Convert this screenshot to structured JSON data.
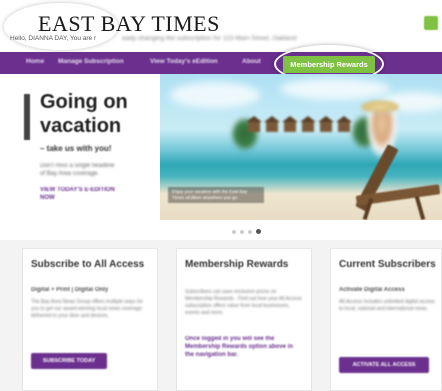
{
  "header": {
    "logo": "EAST BAY TIMES",
    "greeting": "Hello, DIANNA DAY, You are r",
    "greeting_tail": "eady changing the subscription for 123 Main Street, Oakland"
  },
  "nav": {
    "items": [
      {
        "label": "Home"
      },
      {
        "label": "Manage Subscription"
      },
      {
        "label": "View Today's eEdition"
      },
      {
        "label": "About"
      }
    ],
    "rewards_label": "Membership Rewards",
    "accent_color": "#6b2f8e",
    "rewards_color": "#7fc243"
  },
  "hero": {
    "title": "Going on vacation",
    "subtitle": "– take us with you!",
    "body": "Don't miss a single headline of Bay Area coverage.",
    "cta": "VIEW TODAY'S E-EDITION NOW",
    "caption": "Enjoy your vacation with the East Bay Times eEdition anywhere you go.",
    "slides": 4,
    "active_slide": 4
  },
  "cards": [
    {
      "title": "Subscribe to All Access",
      "subtitle": "Digital + Print | Digital Only",
      "body": "The Bay Area News Group offers multiple ways for you to get our award-winning local news coverage delivered to your door and devices.",
      "button": "SUBSCRIBE TODAY"
    },
    {
      "title": "Membership Rewards",
      "body": "Subscribers can save exclusive prices on Membership Rewards - Find out how your All Access subscription offers value from local businesses, events and more.",
      "link": "Once logged in you will see the Membership Rewards option above in the navigation bar."
    },
    {
      "title": "Current Subscribers",
      "subtitle": "Activate Digital Access",
      "body": "All-Access includes unlimited digital access to local, national and international news.",
      "button": "ACTIVATE ALL ACCESS"
    }
  ]
}
